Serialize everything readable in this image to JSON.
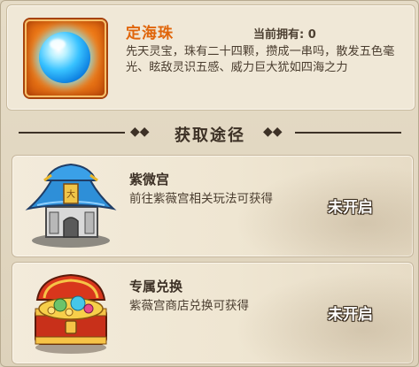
{
  "item": {
    "name": "定海珠",
    "owned_label": "当前拥有:",
    "owned_count": "0",
    "description": "先天灵宝，珠有二十四颗，攒成一串吗，散发五色毫光、眩敌灵识五感、威力巨大犹如四海之力",
    "icon": "sea-pearl-orb-icon"
  },
  "section": {
    "title": "获取途径",
    "ornament_left": "◆◆",
    "ornament_right": "◆◆"
  },
  "sources": [
    {
      "title": "紫微宫",
      "description": "前往紫薇宫相关玩法可获得",
      "status": "未开启",
      "icon": "palace-building-icon"
    },
    {
      "title": "专属兑换",
      "description": "紫薇宫商店兑换可获得",
      "status": "未开启",
      "icon": "treasure-chest-icon"
    }
  ],
  "colors": {
    "item_name": "#e0650a",
    "text_dark": "#3d3126",
    "status_text": "#ffffff"
  }
}
